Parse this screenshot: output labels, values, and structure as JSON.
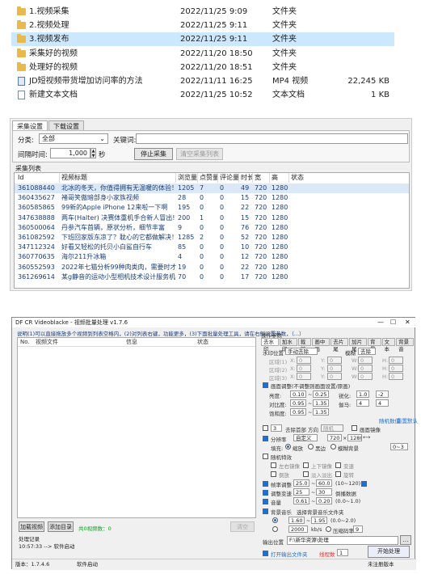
{
  "explorer": {
    "rows": [
      {
        "icon": "folder-icon",
        "name": "1.视频采集",
        "date": "2022/11/25 9:09",
        "type": "文件夹",
        "size": "",
        "selected": false
      },
      {
        "icon": "folder-icon",
        "name": "2.视频处理",
        "date": "2022/11/25 9:11",
        "type": "文件夹",
        "size": "",
        "selected": false
      },
      {
        "icon": "folder-icon",
        "name": "3.视频发布",
        "date": "2022/11/25 9:11",
        "type": "文件夹",
        "size": "",
        "selected": true
      },
      {
        "icon": "folder-icon",
        "name": "采集好的视频",
        "date": "2022/11/20 18:50",
        "type": "文件夹",
        "size": "",
        "selected": false
      },
      {
        "icon": "folder-icon",
        "name": "处理好的视频",
        "date": "2022/11/20 18:51",
        "type": "文件夹",
        "size": "",
        "selected": false
      },
      {
        "icon": "video-file-icon",
        "name": "JD短视频带货增加访问率的方法",
        "date": "2022/11/11 16:25",
        "type": "MP4 视频",
        "size": "22,245 KB",
        "selected": false
      },
      {
        "icon": "text-file-icon",
        "name": "新建文本文档",
        "date": "2022/11/25 10:52",
        "type": "文本文档",
        "size": "1 KB",
        "selected": false
      }
    ]
  },
  "collector": {
    "tabs": [
      "采集设置",
      "下载设置"
    ],
    "category_label": "分类:",
    "category_value": "全部",
    "keyword_label": "关键词:",
    "keyword_value": "",
    "interval_label": "间隔时间:",
    "interval_value": "1,000",
    "interval_unit": "秒",
    "stop_button": "停止采集",
    "clear_button": "清空采集列表",
    "list_title": "采集列表",
    "columns": [
      "Id",
      "视频标题",
      "浏览量",
      "点赞量",
      "评论量",
      "时长",
      "宽",
      "高",
      "状态"
    ],
    "rows": [
      {
        "id": "361088440",
        "title": "北冰的冬天，你值得拥有无温暖的体验！",
        "views": "1205",
        "likes": "7",
        "comments": "0",
        "duration": "49",
        "w": "720",
        "h": "1280",
        "status": ""
      },
      {
        "id": "360435627",
        "title": "褚哥笑傲暗部身小家族视频",
        "views": "28",
        "likes": "0",
        "comments": "0",
        "duration": "15",
        "w": "720",
        "h": "1280",
        "status": ""
      },
      {
        "id": "360585865",
        "title": "99新的Apple iPhone 12来啦一下啊",
        "views": "195",
        "likes": "0",
        "comments": "0",
        "duration": "22",
        "w": "720",
        "h": "1280",
        "status": ""
      },
      {
        "id": "347638888",
        "title": "两车(Halter) 决赛体重机手合新人冒出!",
        "views": "200",
        "likes": "1",
        "comments": "0",
        "duration": "15",
        "w": "720",
        "h": "1280",
        "status": ""
      },
      {
        "id": "360500064",
        "title": "丹参汽车首辆，原状分析，细节丰富",
        "views": "9",
        "likes": "0",
        "comments": "0",
        "duration": "76",
        "w": "720",
        "h": "1280",
        "status": ""
      },
      {
        "id": "361082592",
        "title": "下班回家版东凉了？耽心的它都做解决！",
        "views": "1285",
        "likes": "2",
        "comments": "0",
        "duration": "52",
        "w": "720",
        "h": "1280",
        "status": ""
      },
      {
        "id": "347112324",
        "title": "好看又轻松的托贝小白鲨自行车",
        "views": "85",
        "likes": "0",
        "comments": "0",
        "duration": "10",
        "w": "720",
        "h": "1280",
        "status": ""
      },
      {
        "id": "360770635",
        "title": "海尔211升冰箱",
        "views": "4",
        "likes": "0",
        "comments": "0",
        "duration": "12",
        "w": "720",
        "h": "1280",
        "status": ""
      },
      {
        "id": "360552593",
        "title": "2022年七猫分析99种肉类肉，需要时才能",
        "views": "19",
        "likes": "0",
        "comments": "0",
        "duration": "22",
        "w": "720",
        "h": "1280",
        "status": ""
      },
      {
        "id": "361269614",
        "title": "某g静音的运动小型相机技术设计服务机器",
        "views": "70",
        "likes": "0",
        "comments": "0",
        "duration": "17",
        "w": "720",
        "h": "1280",
        "status": ""
      }
    ]
  },
  "batch": {
    "title": "DF CR Videoblacke - 视频批量处理 v1.7.6",
    "tip": "说明(1)可以直接拖放多个视频到列表空格内，(2)对列表右键，功能更多，(3)下面批量处理工具，请在右侧设置参数，（...）",
    "list_columns": [
      "No.",
      "视频文件",
      "信息",
      "状态"
    ],
    "add_video_button": "加载视频",
    "add_folder_button": "添加目录",
    "count_label": "共0视频数：0",
    "clear_button": "清空",
    "right": {
      "group_title": "操作参数",
      "tabs": [
        "去水印",
        "加水印",
        "裁剪",
        "画中画",
        "去片尾",
        "加片尾",
        "背景",
        "文本",
        "背景音"
      ],
      "remove_watermark_title": "水印位置",
      "remove_watermark_mode": "手动去除",
      "blur_label": "模糊",
      "blur_value": "去除",
      "area_labels": [
        "区域(1)",
        "区域(2)",
        "区域(3)"
      ],
      "x_label": "X:",
      "y_label": "Y:",
      "w_label": "W:",
      "h_label": "H:",
      "x_value": "0",
      "y_value": "0",
      "w_value": "0",
      "h_value": "0",
      "adjust_title": "画面调整(不调整则画面设置/原画)",
      "adjust_rows": [
        {
          "label": "亮度:",
          "a": "0.10",
          "b": "0.25",
          "c_label": "锐化:",
          "c": "1.0",
          "d": "-2"
        },
        {
          "label": "对比度:",
          "a": "0.95",
          "b": "1.35",
          "c_label": "伽马:",
          "c": "4",
          "d": "4"
        },
        {
          "label": "饱和度:",
          "a": "0.95",
          "b": "1.35",
          "c_label": "",
          "c": "",
          "d": ""
        }
      ],
      "random_link": "随机数值",
      "reset_link": "重置默认",
      "duration_label": "去除首部",
      "duration_value": "3",
      "mode_label": "方向",
      "mode_value": "随机",
      "mirror_label": "画面镜像",
      "scale_label": "分辨率",
      "scale_value": "自定义",
      "scale_w": "720",
      "scale_h": "1280",
      "fill_label": "填充:",
      "fill_opts": [
        "缩放",
        "黑边",
        "模糊背景"
      ],
      "fill_pct": "0~3",
      "random_effects_title": "随机特效",
      "effect_items": [
        "左右镜像",
        "上下镜像",
        "变速",
        "倒放",
        "淡入淡出",
        "旋转"
      ],
      "frame_label": "帧率调整",
      "frame_a": "25.0",
      "frame_b": "60.0",
      "frame_note": "(10~120)",
      "speed_label": "调整变速",
      "speed_a": "25",
      "speed_b": "30",
      "speed_note": "倒播数据",
      "volume_label": "音量",
      "volume_a": "0.61",
      "volume_b": "0.20",
      "volume_note": "(0.0~1.0)",
      "bg_label": "背景音乐",
      "bg_note": "选择背景音乐文件夹",
      "bg_vol_a": "1.60",
      "bg_vol_b": "1.95",
      "bg_vol_note": "(0.0~2.0)",
      "bg_mode": "2000",
      "bitrate_label": "kb/s",
      "crf_label": "压缩码率",
      "crf_value": "9",
      "output_label": "输出位置",
      "output_value": "F:\\新华资源\\处理",
      "open_link": "打开输出文件夹",
      "threads_label": "线程数",
      "threads_value": "1",
      "start_button": "开始处理"
    },
    "log_title": "处理记录",
    "log_line": "10:57:33 --> 软件启动",
    "status_left": "版本：1.7.4.6",
    "status_mid": "软件启动",
    "status_right": "未注册版本"
  }
}
